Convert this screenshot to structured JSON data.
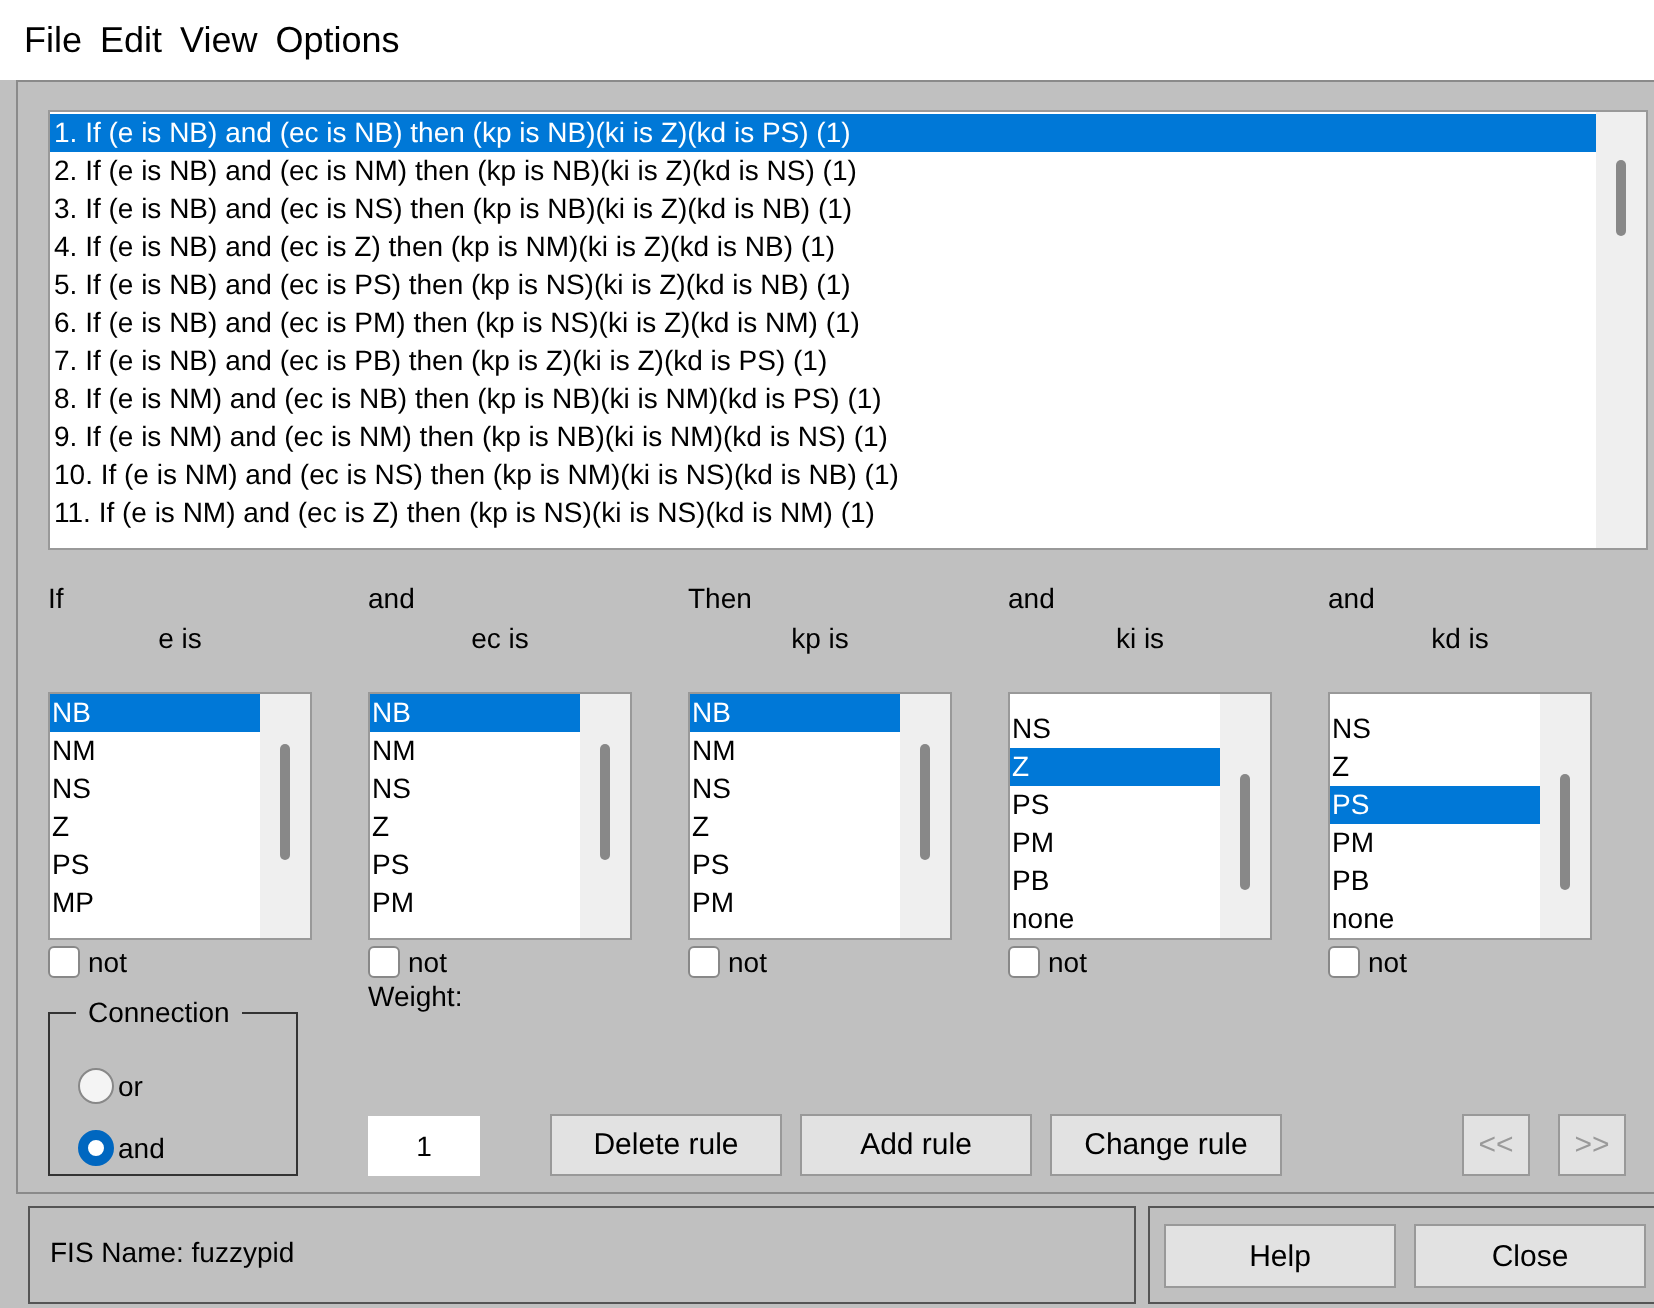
{
  "menu": [
    "File",
    "Edit",
    "View",
    "Options"
  ],
  "rules": [
    {
      "text": "1. If (e is NB) and (ec is NB) then (kp is NB)(ki is Z)(kd is PS) (1)",
      "selected": true
    },
    {
      "text": "2. If (e is NB) and (ec is NM) then (kp is NB)(ki is Z)(kd is NS) (1)",
      "selected": false
    },
    {
      "text": "3. If (e is NB) and (ec is NS) then (kp is NB)(ki is Z)(kd is NB) (1)",
      "selected": false
    },
    {
      "text": "4. If (e is NB) and (ec is Z) then (kp is NM)(ki is Z)(kd is NB) (1)",
      "selected": false
    },
    {
      "text": "5. If (e is NB) and (ec is PS) then (kp is NS)(ki is Z)(kd is NB) (1)",
      "selected": false
    },
    {
      "text": "6. If (e is NB) and (ec is PM) then (kp is NS)(ki is Z)(kd is NM) (1)",
      "selected": false
    },
    {
      "text": "7. If (e is NB) and (ec is PB) then (kp is Z)(ki is Z)(kd is PS) (1)",
      "selected": false
    },
    {
      "text": "8. If (e is NM) and (ec is NB) then (kp is NB)(ki is NM)(kd is PS) (1)",
      "selected": false
    },
    {
      "text": "9. If (e is NM) and (ec is NM) then (kp is NB)(ki is NM)(kd is NS) (1)",
      "selected": false
    },
    {
      "text": "10. If (e is NM) and (ec is NS) then (kp is NM)(ki is NS)(kd is NB) (1)",
      "selected": false
    },
    {
      "text": "11. If (e is NM) and (ec is Z) then (kp is NS)(ki is NS)(kd is NM) (1)",
      "selected": false
    }
  ],
  "variables": [
    {
      "heading": "If",
      "label": "e is",
      "scrolled": false,
      "not_checked": false,
      "not_label": "not",
      "items": [
        {
          "text": "NB",
          "selected": true
        },
        {
          "text": "NM",
          "selected": false
        },
        {
          "text": "NS",
          "selected": false
        },
        {
          "text": "Z",
          "selected": false
        },
        {
          "text": "PS",
          "selected": false
        },
        {
          "text": "MP",
          "selected": false
        }
      ]
    },
    {
      "heading": "and",
      "label": "ec is",
      "scrolled": false,
      "not_checked": false,
      "not_label": "not",
      "items": [
        {
          "text": "NB",
          "selected": true
        },
        {
          "text": "NM",
          "selected": false
        },
        {
          "text": "NS",
          "selected": false
        },
        {
          "text": "Z",
          "selected": false
        },
        {
          "text": "PS",
          "selected": false
        },
        {
          "text": "PM",
          "selected": false
        }
      ]
    },
    {
      "heading": "Then",
      "label": "kp is",
      "scrolled": false,
      "not_checked": false,
      "not_label": "not",
      "items": [
        {
          "text": "NB",
          "selected": true
        },
        {
          "text": "NM",
          "selected": false
        },
        {
          "text": "NS",
          "selected": false
        },
        {
          "text": "Z",
          "selected": false
        },
        {
          "text": "PS",
          "selected": false
        },
        {
          "text": "PM",
          "selected": false
        }
      ]
    },
    {
      "heading": "and",
      "label": "ki is",
      "scrolled": true,
      "not_checked": false,
      "not_label": "not",
      "items": [
        {
          "text": "NS",
          "selected": false
        },
        {
          "text": "Z",
          "selected": true
        },
        {
          "text": "PS",
          "selected": false
        },
        {
          "text": "PM",
          "selected": false
        },
        {
          "text": "PB",
          "selected": false
        },
        {
          "text": "none",
          "selected": false
        }
      ]
    },
    {
      "heading": "and",
      "label": "kd is",
      "scrolled": true,
      "not_checked": false,
      "not_label": "not",
      "items": [
        {
          "text": "NS",
          "selected": false
        },
        {
          "text": "Z",
          "selected": false
        },
        {
          "text": "PS",
          "selected": true
        },
        {
          "text": "PM",
          "selected": false
        },
        {
          "text": "PB",
          "selected": false
        },
        {
          "text": "none",
          "selected": false
        }
      ]
    }
  ],
  "connection": {
    "title": "Connection",
    "options": [
      {
        "label": "or",
        "selected": false
      },
      {
        "label": "and",
        "selected": true
      }
    ]
  },
  "weight": {
    "label": "Weight:",
    "value": "1"
  },
  "rule_buttons": [
    {
      "label": "Delete rule",
      "disabled": false
    },
    {
      "label": "Add rule",
      "disabled": false
    },
    {
      "label": "Change rule",
      "disabled": false
    }
  ],
  "nav_buttons": [
    {
      "label": "<<",
      "disabled": true
    },
    {
      "label": ">>",
      "disabled": true
    }
  ],
  "status": "FIS Name: fuzzypid",
  "footer_buttons": [
    "Help",
    "Close"
  ]
}
